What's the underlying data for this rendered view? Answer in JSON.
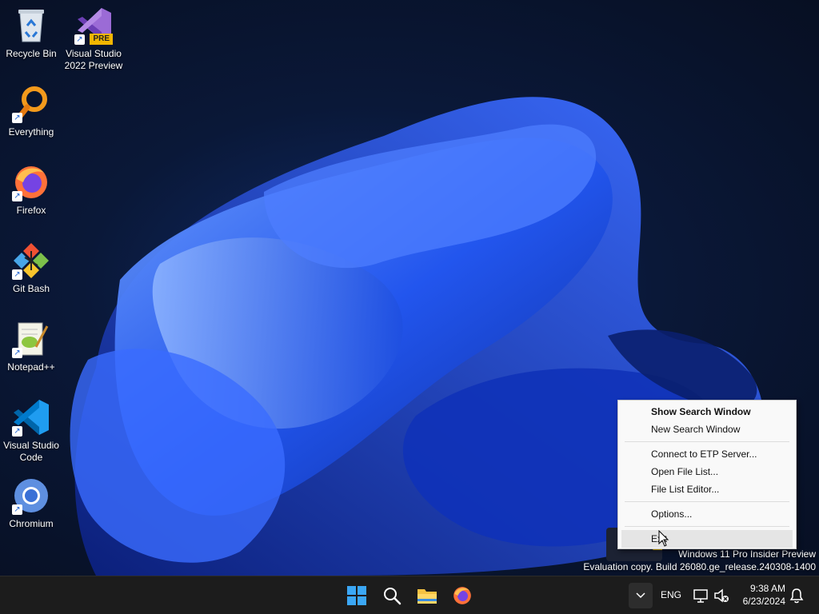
{
  "desktop_icons": [
    {
      "name": "Recycle Bin",
      "icon": "recycle-bin-icon"
    },
    {
      "name": "Visual Studio\n2022 Preview",
      "icon": "visual-studio-icon",
      "badge": "PRE"
    },
    {
      "name": "Everything",
      "icon": "everything-search-icon"
    },
    {
      "name": "Firefox",
      "icon": "firefox-icon"
    },
    {
      "name": "Git Bash",
      "icon": "git-bash-icon"
    },
    {
      "name": "Notepad++",
      "icon": "notepadpp-icon"
    },
    {
      "name": "Visual Studio\nCode",
      "icon": "vscode-icon"
    },
    {
      "name": "Chromium",
      "icon": "chromium-icon"
    }
  ],
  "shortcut_arrow": "↗",
  "context_menu": {
    "items": [
      {
        "label": "Show Search Window",
        "bold": true
      },
      {
        "label": "New Search Window"
      },
      {
        "label": "Connect to ETP Server..."
      },
      {
        "label": "Open File List..."
      },
      {
        "label": "File List Editor..."
      },
      {
        "label": "Options..."
      },
      {
        "label": "Exit",
        "hovered": true
      }
    ]
  },
  "watermark": {
    "line1": "Windows 11 Pro Insider Preview",
    "line2": "Evaluation copy. Build 26080.ge_release.240308-1400"
  },
  "taskbar": {
    "apps": [
      "start-icon",
      "search-icon",
      "file-explorer-icon",
      "firefox-icon"
    ],
    "language": "ENG",
    "time": "9:38 AM",
    "date": "6/23/2024"
  },
  "colors": {
    "taskbar_bg": "#1c1c1c",
    "menu_bg": "#f9f9f9",
    "accent": "#1a5fd0"
  }
}
